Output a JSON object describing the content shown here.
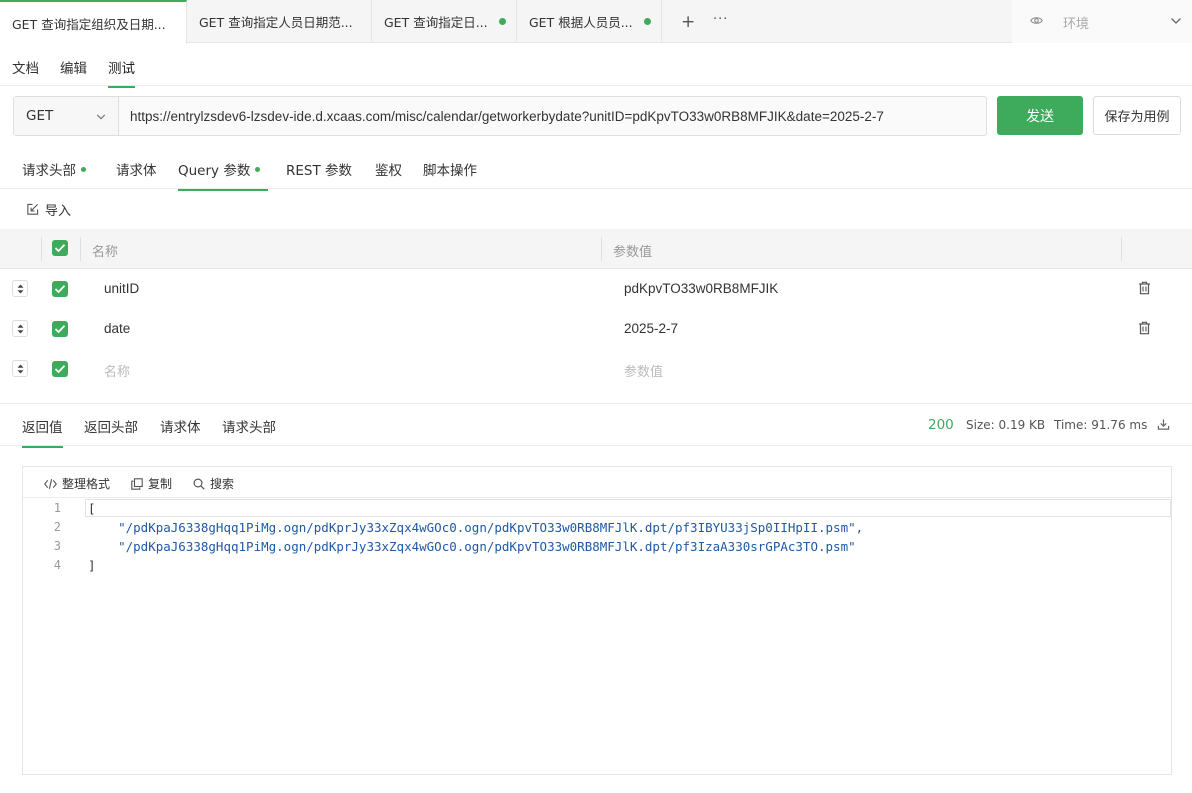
{
  "tabs": [
    {
      "label": "GET 查询指定组织及日期...",
      "active": true,
      "dot": false
    },
    {
      "label": "GET 查询指定人员日期范...",
      "active": false,
      "dot": false
    },
    {
      "label": "GET 查询指定日...",
      "active": false,
      "dot": true
    },
    {
      "label": "GET 根据人员员...",
      "active": false,
      "dot": true
    }
  ],
  "tab_add": "+",
  "tab_more": "···",
  "env": {
    "label": "环境"
  },
  "modes": [
    "文档",
    "编辑",
    "测试"
  ],
  "request": {
    "method": "GET",
    "url": "https://entrylzsdev6-lzsdev-ide.d.xcaas.com/misc/calendar/getworkerbydate?unitID=pdKpvTO33w0RB8MFJIK&date=2025-2-7",
    "send_label": "发送",
    "save_label": "保存为用例"
  },
  "req_tabs": [
    "请求头部",
    "请求体",
    "Query 参数",
    "REST 参数",
    "鉴权",
    "脚本操作"
  ],
  "import_label": "导入",
  "params": {
    "header_name": "名称",
    "header_value": "参数值",
    "rows": [
      {
        "name": "unitID",
        "value": "pdKpvTO33w0RB8MFJIK"
      },
      {
        "name": "date",
        "value": "2025-2-7"
      }
    ],
    "placeholder_name": "名称",
    "placeholder_value": "参数值"
  },
  "res_tabs": [
    "返回值",
    "返回头部",
    "请求体",
    "请求头部"
  ],
  "response": {
    "status": "200",
    "size": "Size: 0.19 KB",
    "time": "Time: 91.76 ms"
  },
  "code_tools": [
    "整理格式",
    "复制",
    "搜索"
  ],
  "code_lines": [
    {
      "num": "1",
      "text": "["
    },
    {
      "num": "2",
      "text": "    \"/pdKpaJ6338gHqq1PiMg.ogn/pdKprJy33xZqx4wGOc0.ogn/pdKpvTO33w0RB8MFJlK.dpt/pf3IBYU33jSp0IIHpII.psm\","
    },
    {
      "num": "3",
      "text": "    \"/pdKpaJ6338gHqq1PiMg.ogn/pdKprJy33xZqx4wGOc0.ogn/pdKpvTO33w0RB8MFJlK.dpt/pf3IzaA330srGPAc3TO.psm\""
    },
    {
      "num": "4",
      "text": "]"
    }
  ],
  "colors": {
    "accent": "#3daa5c",
    "string": "#1f5aa6"
  }
}
